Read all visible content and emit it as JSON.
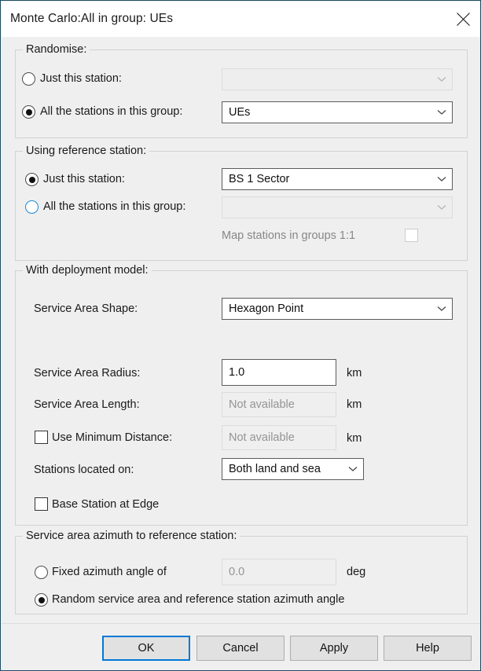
{
  "window": {
    "title": "Monte Carlo:All in group: UEs",
    "close_icon": "close-icon"
  },
  "randomise": {
    "legend": "Randomise:",
    "just_station": {
      "label": "Just this station:",
      "selected": false,
      "combo_value": "",
      "enabled": false
    },
    "all_stations": {
      "label": "All the stations in this group:",
      "selected": true,
      "combo_value": "UEs",
      "enabled": true
    }
  },
  "reference": {
    "legend": "Using reference station:",
    "just_station": {
      "label": "Just this station:",
      "selected": true,
      "combo_value": "BS 1 Sector",
      "enabled": true
    },
    "all_stations": {
      "label": "All the stations in this group:",
      "selected": false,
      "combo_value": "",
      "enabled": false
    },
    "map_11": {
      "label": "Map stations in groups 1:1",
      "checked": false,
      "enabled": false
    }
  },
  "deployment": {
    "legend": "With deployment model:",
    "shape": {
      "label": "Service Area Shape:",
      "value": "Hexagon Point"
    },
    "radius": {
      "label": "Service Area Radius:",
      "value": "1.0",
      "unit": "km"
    },
    "length": {
      "label": "Service Area Length:",
      "value": "Not available",
      "unit": "km",
      "enabled": false
    },
    "min_distance": {
      "label": "Use Minimum Distance:",
      "checked": false,
      "value": "Not available",
      "unit": "km",
      "enabled": false
    },
    "located_on": {
      "label": "Stations located on:",
      "value": "Both land and sea"
    },
    "base_station_edge": {
      "label": "Base Station at Edge",
      "checked": false
    }
  },
  "azimuth": {
    "legend": "Service area azimuth to reference station:",
    "fixed": {
      "label": "Fixed azimuth angle of",
      "selected": false,
      "value": "0.0",
      "unit": "deg",
      "enabled": false
    },
    "random": {
      "label": "Random service area and reference station azimuth angle",
      "selected": true
    }
  },
  "buttons": {
    "ok": "OK",
    "cancel": "Cancel",
    "apply": "Apply",
    "help": "Help"
  },
  "colors": {
    "accent": "#0078d7",
    "frame": "#1d4e63",
    "surface": "#efefef"
  }
}
